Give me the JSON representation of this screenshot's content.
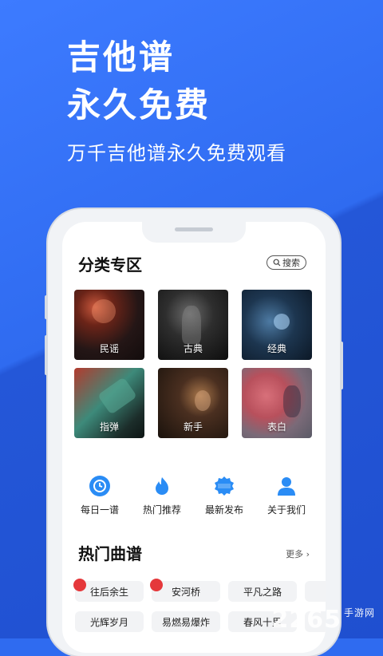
{
  "hero": {
    "line1": "吉他谱",
    "line2": "永久免费",
    "subtitle": "万千吉他谱永久免费观看"
  },
  "category": {
    "title": "分类专区",
    "search_label": "搜索",
    "tiles": [
      {
        "label": "民谣"
      },
      {
        "label": "古典"
      },
      {
        "label": "经典"
      },
      {
        "label": "指弹"
      },
      {
        "label": "新手"
      },
      {
        "label": "表白"
      }
    ]
  },
  "quick_links": [
    {
      "label": "每日一谱",
      "icon": "clock-icon"
    },
    {
      "label": "热门推荐",
      "icon": "flame-icon"
    },
    {
      "label": "最新发布",
      "icon": "new-badge-icon"
    },
    {
      "label": "关于我们",
      "icon": "user-icon"
    }
  ],
  "hot": {
    "title": "热门曲谱",
    "more": "更多",
    "songs": [
      {
        "label": "往后余生",
        "hot": true
      },
      {
        "label": "安河桥",
        "hot": true
      },
      {
        "label": "平凡之路",
        "hot": false
      },
      {
        "label": "光辉岁月",
        "hot": false
      },
      {
        "label": "易燃易爆炸",
        "hot": false
      },
      {
        "label": "春风十里",
        "hot": false
      }
    ]
  },
  "watermark": {
    "text": "2265",
    "suffix": "手游网"
  },
  "colors": {
    "brand_blue": "#2f6bf0",
    "icon_blue": "#2a8cf5",
    "hot_red": "#e5383b"
  }
}
